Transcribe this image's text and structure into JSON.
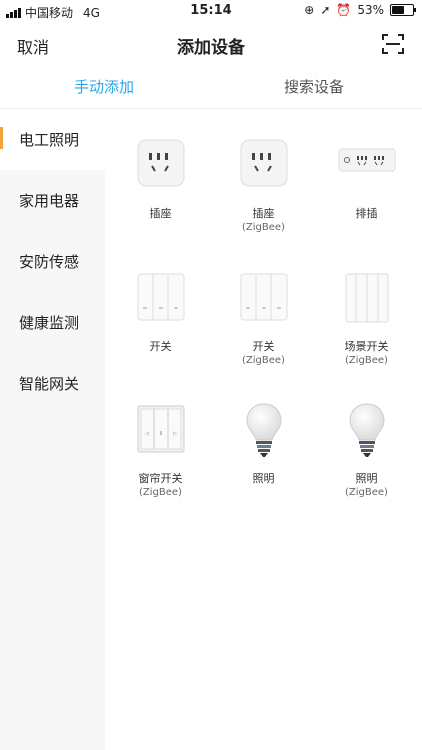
{
  "status_bar": {
    "carrier": "中国移动",
    "network": "4G",
    "time": "15:14",
    "battery": "53%",
    "battery_level": 0.53
  },
  "navbar": {
    "cancel": "取消",
    "title": "添加设备"
  },
  "tabs": [
    {
      "label": "手动添加",
      "active": true
    },
    {
      "label": "搜索设备",
      "active": false
    }
  ],
  "sidebar": {
    "items": [
      {
        "label": "电工照明",
        "active": true
      },
      {
        "label": "家用电器"
      },
      {
        "label": "安防传感"
      },
      {
        "label": "健康监测"
      },
      {
        "label": "智能网关"
      }
    ]
  },
  "devices": [
    {
      "name": "插座",
      "sub": "",
      "icon": "socket-icon"
    },
    {
      "name": "插座",
      "sub": "(ZigBee)",
      "icon": "socket-icon"
    },
    {
      "name": "排插",
      "sub": "",
      "icon": "power-strip-icon"
    },
    {
      "name": "开关",
      "sub": "",
      "icon": "switch-icon"
    },
    {
      "name": "开关",
      "sub": "(ZigBee)",
      "icon": "switch-icon"
    },
    {
      "name": "场景开关",
      "sub": "(ZigBee)",
      "icon": "scene-switch-icon"
    },
    {
      "name": "窗帘开关",
      "sub": "(ZigBee)",
      "icon": "curtain-switch-icon"
    },
    {
      "name": "照明",
      "sub": "",
      "icon": "bulb-icon"
    },
    {
      "name": "照明",
      "sub": "(ZigBee)",
      "icon": "bulb-icon"
    }
  ],
  "colors": {
    "accent": "#2aa6ea",
    "indicator": "#f2a33a"
  }
}
